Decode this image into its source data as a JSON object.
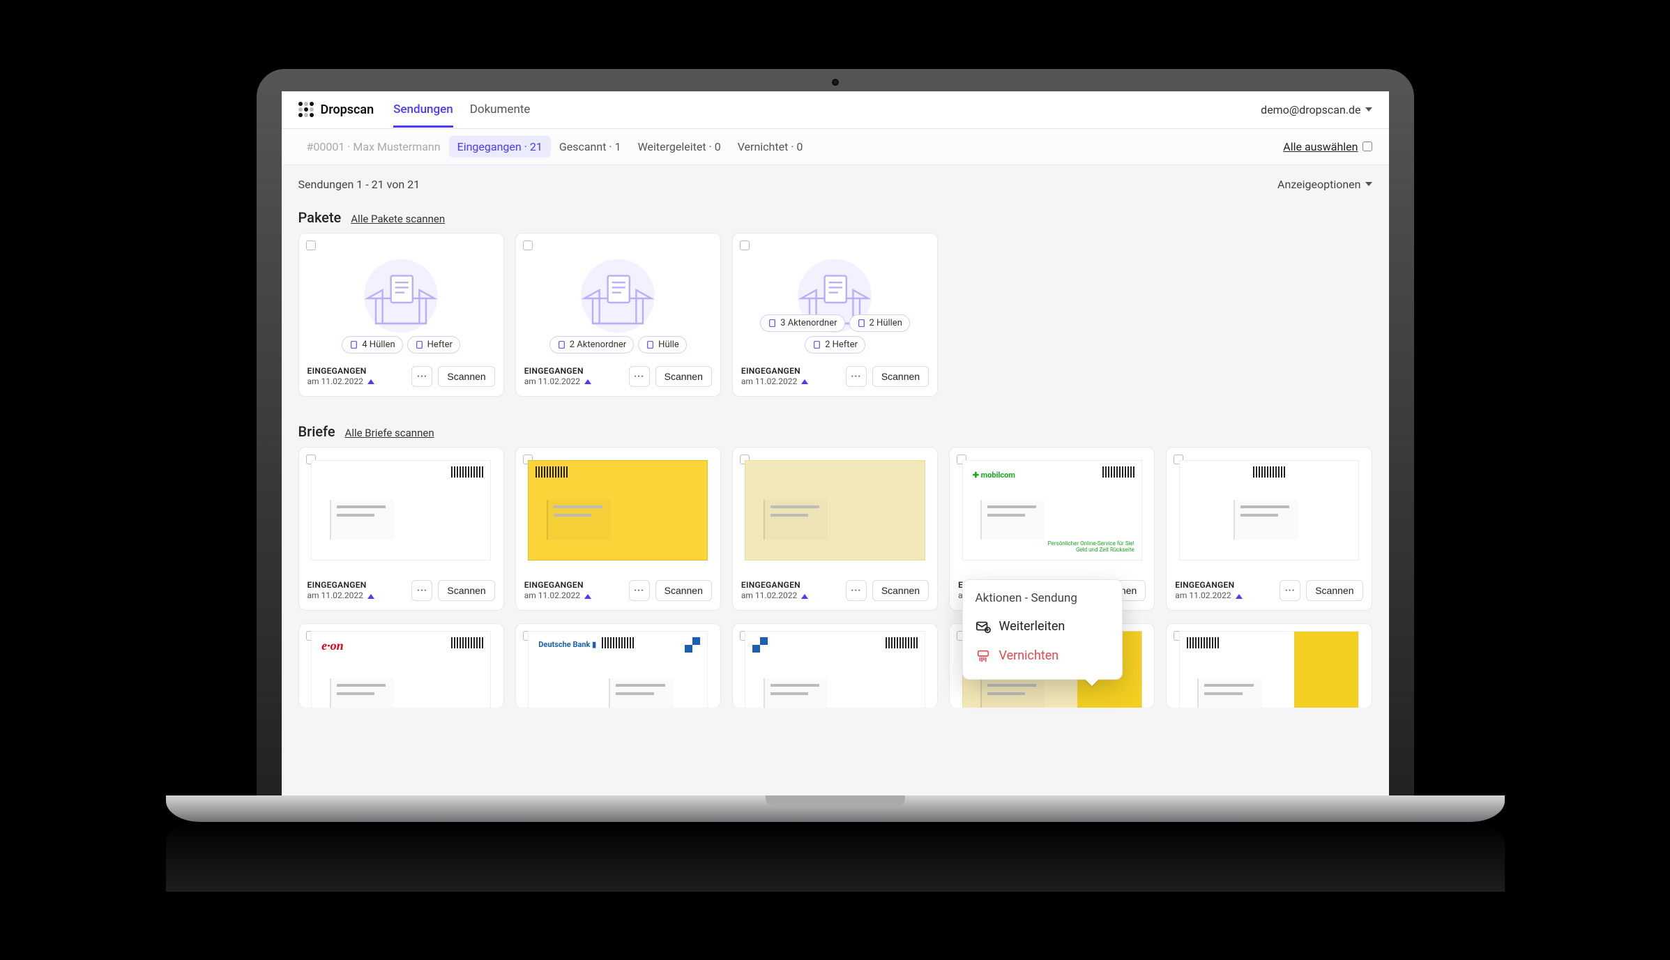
{
  "header": {
    "brand": "Dropscan",
    "nav": {
      "sendungen": "Sendungen",
      "dokumente": "Dokumente"
    },
    "user_email": "demo@dropscan.de"
  },
  "filterbar": {
    "crumb": "#00001 · Max Mustermann",
    "pills": {
      "incoming": "Eingegangen · 21",
      "scanned": "Gescannt · 1",
      "forwarded": "Weitergeleitet · 0",
      "destroyed": "Vernichtet · 0"
    },
    "select_all": "Alle auswählen"
  },
  "subbar": {
    "range": "Sendungen 1 - 21 von 21",
    "display_options": "Anzeigeoptionen"
  },
  "sections": {
    "pakete": {
      "title": "Pakete",
      "link": "Alle Pakete scannen"
    },
    "briefe": {
      "title": "Briefe",
      "link": "Alle Briefe scannen"
    }
  },
  "packages": [
    {
      "tags": [
        "4 Hüllen",
        "Hefter"
      ],
      "status": "EINGEGANGEN",
      "date": "am 11.02.2022"
    },
    {
      "tags": [
        "2 Aktenordner",
        "Hülle"
      ],
      "status": "EINGEGANGEN",
      "date": "am 11.02.2022"
    },
    {
      "tags": [
        "3 Aktenordner",
        "2 Hüllen",
        "2 Hefter"
      ],
      "status": "EINGEGANGEN",
      "date": "am 11.02.2022"
    }
  ],
  "letters_row1": [
    {
      "status": "EINGEGANGEN",
      "date": "am 11.02.2022"
    },
    {
      "status": "EINGEGANGEN",
      "date": "am 11.02.2022"
    },
    {
      "status": "EINGEGANGEN",
      "date": "am 11.02.2022"
    },
    {
      "status": "EINGEGANGEN",
      "date": "am 11.02.2022"
    },
    {
      "status": "EINGEGANGEN",
      "date": "am 11.02.2022"
    }
  ],
  "labels": {
    "more": "···",
    "scan": "Scannen"
  },
  "popover": {
    "title": "Aktionen - Sendung",
    "forward": "Weiterleiten",
    "destroy": "Vernichten"
  }
}
